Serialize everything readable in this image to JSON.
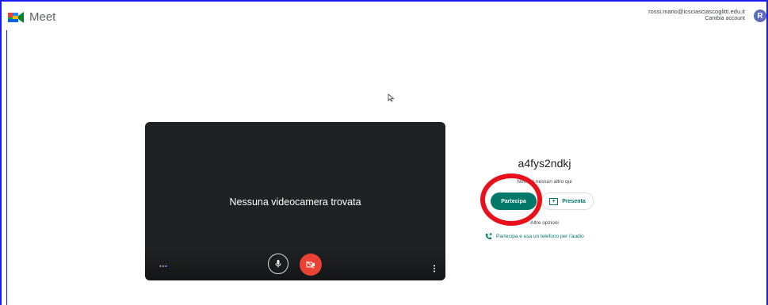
{
  "header": {
    "app_name": "Meet",
    "account_email": "rossi.mario@icsciasciascoglitti.edu.it",
    "switch_account_label": "Cambia account",
    "avatar_initial": "R"
  },
  "preview": {
    "no_camera_text": "Nessuna videocamera trovata",
    "mic_icon": "microphone-icon",
    "camera_icon": "camera-off-icon"
  },
  "join_panel": {
    "meeting_code": "a4fys2ndkj",
    "nobody_here_text": "Non c'è nessun altro qui",
    "join_label": "Partecipa",
    "present_label": "Presenta",
    "other_options_label": "Altre opzioni",
    "phone_audio_label": "Partecipa e usa un telefono per l'audio"
  },
  "colors": {
    "accent": "#00796b",
    "camera_off": "#ea4335",
    "annotation_ring": "#e8101a"
  }
}
